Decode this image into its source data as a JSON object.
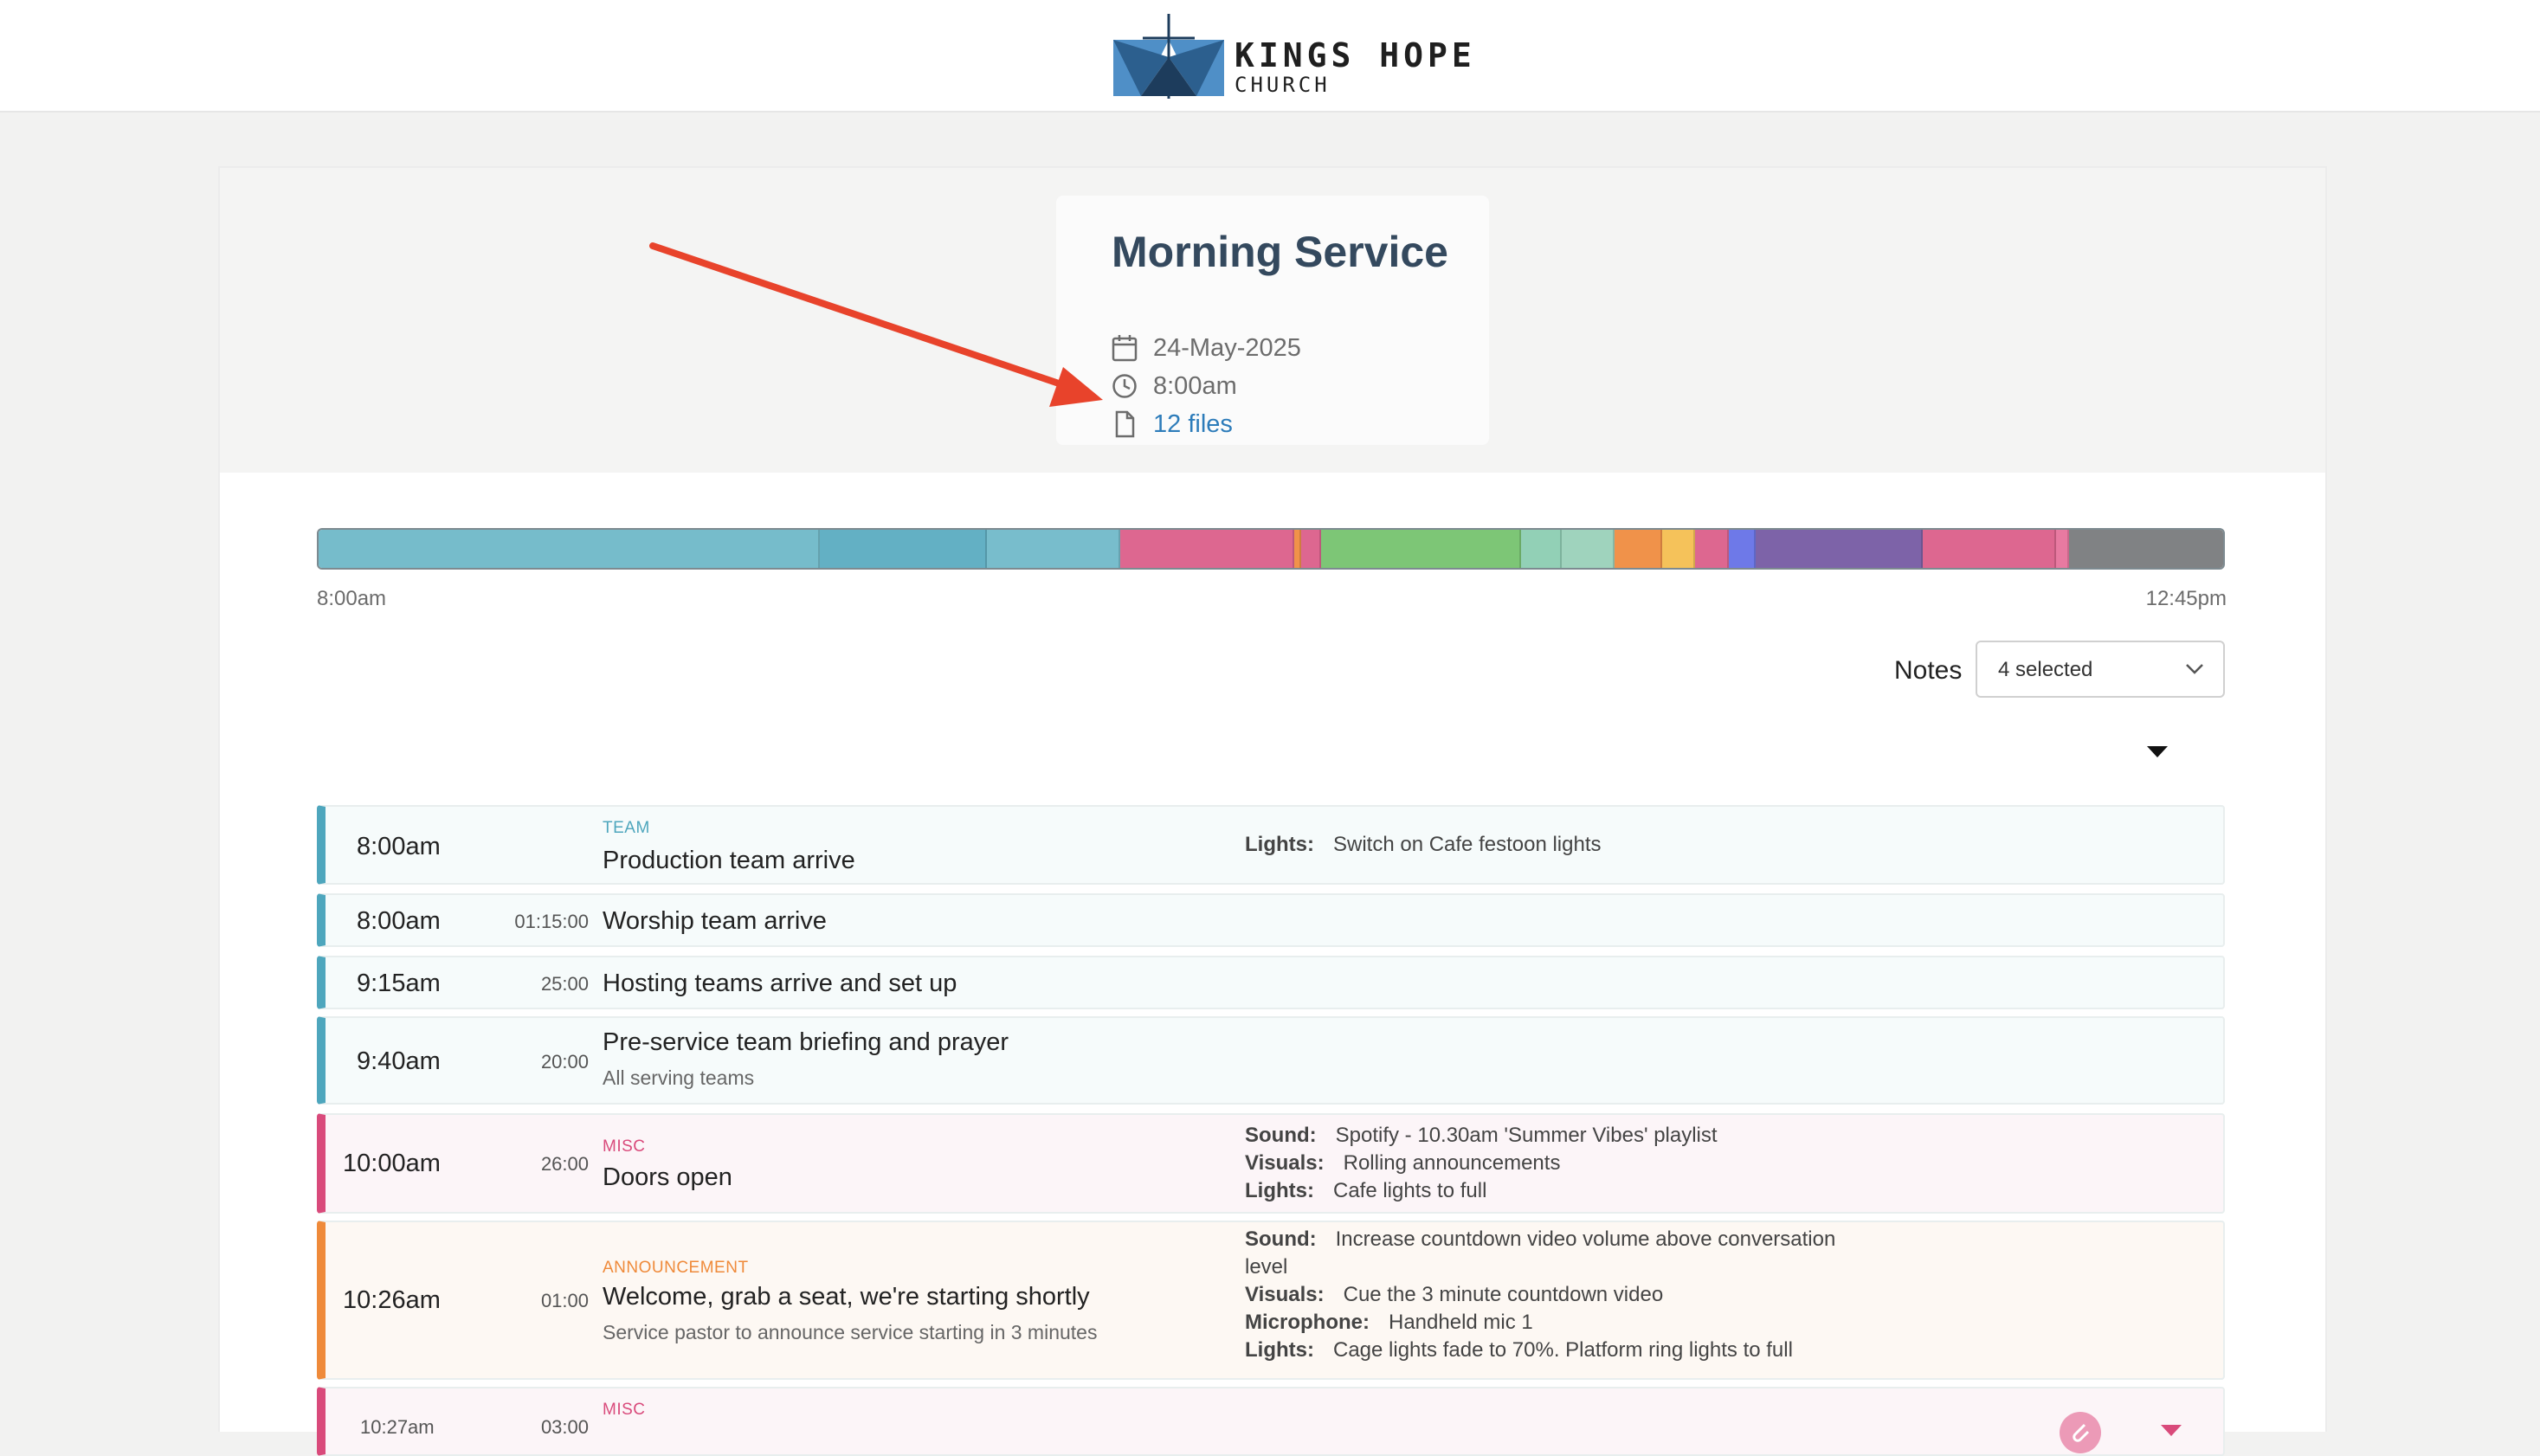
{
  "header": {
    "brand_name": "KINGS HOPE",
    "brand_sub": "CHURCH"
  },
  "service": {
    "title": "Morning Service",
    "date": "24-May-2025",
    "time": "8:00am",
    "files_link": "12 files"
  },
  "timeline": {
    "start_label": "8:00am",
    "end_label": "12:45pm",
    "segments": [
      {
        "color": "#76bccb",
        "minutes": 75
      },
      {
        "color": "#63b0c4",
        "minutes": 25
      },
      {
        "color": "#78bdcc",
        "minutes": 20
      },
      {
        "color": "#dd6790",
        "minutes": 26
      },
      {
        "color": "#f0924a",
        "minutes": 1
      },
      {
        "color": "#dd6790",
        "minutes": 3
      },
      {
        "color": "#7dc676",
        "minutes": 30
      },
      {
        "color": "#92d0b6",
        "minutes": 6
      },
      {
        "color": "#9fd3bd",
        "minutes": 8
      },
      {
        "color": "#f0924a",
        "minutes": 7
      },
      {
        "color": "#f5c25a",
        "minutes": 5
      },
      {
        "color": "#dd6790",
        "minutes": 5
      },
      {
        "color": "#6e79e8",
        "minutes": 4
      },
      {
        "color": "#7d63a8",
        "minutes": 25
      },
      {
        "color": "#dd6790",
        "minutes": 20
      },
      {
        "color": "#e87aa1",
        "minutes": 2
      },
      {
        "color": "#808284",
        "minutes": 23
      }
    ]
  },
  "notes_filter": {
    "label": "Notes",
    "value": "4 selected"
  },
  "items": [
    {
      "time": "8:00am",
      "duration": "",
      "category": "TEAM",
      "title": "Production team arrive",
      "description": "",
      "notes": [
        {
          "k": "Lights:",
          "v": "Switch on Cafe festoon lights"
        }
      ]
    },
    {
      "time": "8:00am",
      "duration": "01:15:00",
      "category": "",
      "title": "Worship team arrive",
      "description": "",
      "notes": []
    },
    {
      "time": "9:15am",
      "duration": "25:00",
      "category": "",
      "title": "Hosting teams arrive and set up",
      "description": "",
      "notes": []
    },
    {
      "time": "9:40am",
      "duration": "20:00",
      "category": "",
      "title": "Pre-service team briefing and prayer",
      "description": "All serving teams",
      "notes": []
    },
    {
      "time": "10:00am",
      "duration": "26:00",
      "category": "MISC",
      "title": "Doors open",
      "description": "",
      "notes": [
        {
          "k": "Sound:",
          "v": "Spotify - 10.30am 'Summer Vibes' playlist"
        },
        {
          "k": "Visuals:",
          "v": "Rolling announcements"
        },
        {
          "k": "Lights:",
          "v": "Cafe lights to full"
        }
      ]
    },
    {
      "time": "10:26am",
      "duration": "01:00",
      "category": "ANNOUNCEMENT",
      "title": "Welcome, grab a seat, we're starting shortly",
      "description": "Service pastor to announce service starting in 3 minutes",
      "notes": [
        {
          "k": "Sound:",
          "v": "Increase countdown video volume above conversation level"
        },
        {
          "k": "Visuals:",
          "v": "Cue the 3 minute countdown video"
        },
        {
          "k": "Microphone:",
          "v": "Handheld mic 1"
        },
        {
          "k": "Lights:",
          "v": "Cage lights fade to 70%. Platform ring lights to full"
        }
      ]
    },
    {
      "time": "10:27am",
      "duration": "03:00",
      "category": "MISC",
      "title": "",
      "description": "",
      "notes": []
    }
  ],
  "colors": {
    "team": "#4ea6bd",
    "misc": "#d94a7b",
    "announcement": "#ef8a3a",
    "link": "#2d7cba",
    "arrow": "#e8432b"
  }
}
